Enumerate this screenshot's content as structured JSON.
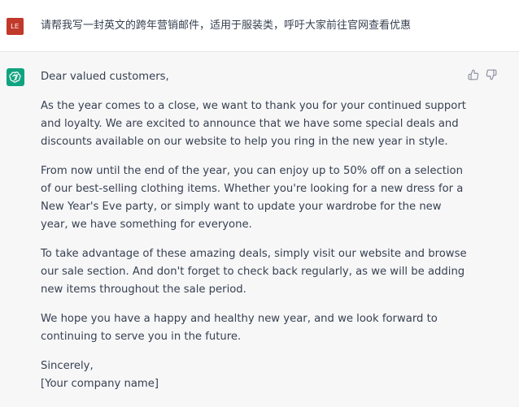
{
  "user": {
    "avatar_initials": "LE",
    "avatar_color": "#c0392b",
    "message": "请帮我写一封英文的跨年营销邮件，适用于服装类，呼吁大家前往官网查看优惠"
  },
  "assistant": {
    "avatar_icon": "openai-logo-icon",
    "avatar_color": "#10a37f",
    "paragraphs": [
      "Dear valued customers,",
      "As the year comes to a close, we want to thank you for your continued support and loyalty. We are excited to announce that we have some special deals and discounts available on our website to help you ring in the new year in style.",
      "From now until the end of the year, you can enjoy up to 50% off on a selection of our best-selling clothing items. Whether you're looking for a new dress for a New Year's Eve party, or simply want to update your wardrobe for the new year, we have something for everyone.",
      "To take advantage of these amazing deals, simply visit our website and browse our sale section. And don't forget to check back regularly, as we will be adding new items throughout the sale period.",
      "We hope you have a happy and healthy new year, and we look forward to continuing to serve you in the future."
    ],
    "closing": "Sincerely,",
    "signature": "[Your company name]"
  },
  "feedback": {
    "thumbs_up_icon": "thumbs-up-icon",
    "thumbs_down_icon": "thumbs-down-icon"
  }
}
